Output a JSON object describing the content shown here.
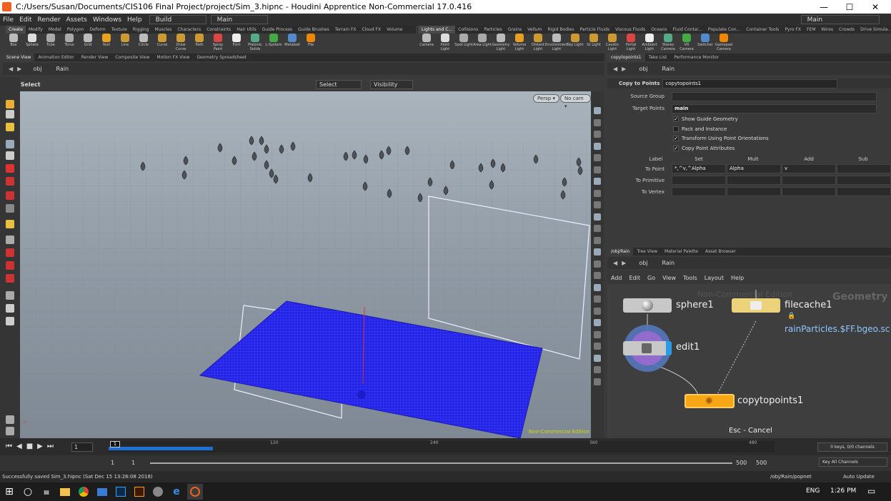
{
  "window": {
    "title": "C:/Users/Susan/Documents/CIS106 Final Project/project/Sim_3.hipnc - Houdini Apprentice Non-Commercial 17.0.416",
    "minimize": "—",
    "maximize": "☐",
    "close": "✕"
  },
  "menu": {
    "items": [
      "File",
      "Edit",
      "Render",
      "Assets",
      "Windows",
      "Help"
    ],
    "desktop": "Build",
    "context": "Main",
    "right_context": "Main"
  },
  "shelf": {
    "tabs_left": [
      "Create",
      "Modify",
      "Model",
      "Polygon",
      "Deform",
      "Texture",
      "Rigging",
      "Muscles",
      "Characters",
      "Constraints",
      "Hair Utils",
      "Guide Process",
      "Guide Brushes",
      "Terrain FX",
      "Cloud FX",
      "Volume"
    ],
    "tabs_right": [
      "Lights and C...",
      "Collisions",
      "Particles",
      "Grains",
      "Vellum",
      "Rigid Bodies",
      "Particle Fluids",
      "Viscous Fluids",
      "Oceans",
      "Fluid Contai...",
      "Populate Con...",
      "Container Tools",
      "Pyro FX",
      "FEM",
      "Wires",
      "Crowds",
      "Drive Simula..."
    ],
    "tools_left": [
      "Box",
      "Sphere",
      "Tube",
      "Torus",
      "Grid",
      "Null",
      "Line",
      "Circle",
      "Curve",
      "Draw Curve",
      "Path",
      "Spray Paint",
      "Font",
      "Platonic Solids",
      "L-System",
      "Metaball",
      "File"
    ],
    "tools_right": [
      "Camera",
      "Point Light",
      "Spot Light",
      "Area Light",
      "Geometry Light",
      "Volume Light",
      "Distant Light",
      "Environment Light",
      "Sky Light",
      "GI Light",
      "Caustic Light",
      "Portal Light",
      "Ambient Light",
      "Stereo Camera",
      "VR Camera",
      "Switcher",
      "Gamepad Camera"
    ]
  },
  "left_pane": {
    "tabs": [
      "Scene View",
      "Animation Editor",
      "Render View",
      "Composite View",
      "Motion FX View",
      "Geometry Spreadsheet"
    ],
    "path": [
      "obj",
      "Rain"
    ],
    "tool": "Select",
    "select_mode": "Select",
    "visibility": "Visibility",
    "persp": "Persp",
    "cam": "No cam",
    "watermark": "Non-Commercial Edition"
  },
  "right_top": {
    "tabs": [
      "copytopoints1",
      "Take List",
      "Performance Monitor"
    ],
    "path": [
      "obj",
      "Rain"
    ],
    "node_type": "Copy to Points",
    "node_name": "copytopoints1",
    "source_group_label": "Source Group",
    "source_group_value": "",
    "target_points_label": "Target Points",
    "target_points_value": "main",
    "checks": [
      {
        "label": "Show Guide Geometry",
        "checked": "✓"
      },
      {
        "label": "Pack and Instance",
        "checked": ""
      },
      {
        "label": "Transform Using Point Orientations",
        "checked": "✓"
      },
      {
        "label": "Copy Point Attributes",
        "checked": "✓"
      }
    ],
    "cols": [
      "Label",
      "Set",
      "Mult",
      "Add",
      "Sub"
    ],
    "rows": [
      {
        "label": "To Point",
        "set": "*,^v,^Alpha",
        "mult": "Alpha",
        "add": "v",
        "sub": ""
      },
      {
        "label": "To Primitive",
        "set": "",
        "mult": "",
        "add": "",
        "sub": ""
      },
      {
        "label": "To Vertex",
        "set": "",
        "mult": "",
        "add": "",
        "sub": ""
      }
    ]
  },
  "right_bottom": {
    "tabs": [
      "/obj/Rain",
      "Tree View",
      "Material Palette",
      "Asset Browser"
    ],
    "path": [
      "obj",
      "Rain"
    ],
    "menu": [
      "Add",
      "Edit",
      "Go",
      "View",
      "Tools",
      "Layout",
      "Help"
    ],
    "watermark": "Non-Commercial Edition",
    "context_label": "Geometry",
    "nodes": {
      "sphere": "sphere1",
      "filecache": "filecache1",
      "filecache_path": "rainParticles.$FF.bgeo.sc",
      "edit": "edit1",
      "copy": "copytopoints1"
    },
    "hint": "Esc - Cancel"
  },
  "timeline": {
    "current_frame": "1",
    "frame_field": "1",
    "ticks": [
      "120",
      "240",
      "360",
      "480"
    ],
    "keys": "0 keys, 0/0 channels",
    "key_channels": "Key All Channels",
    "progress": 0.27
  },
  "range": {
    "start": "1",
    "start2": "1",
    "end": "500",
    "end2": "500"
  },
  "status": {
    "message": "Successfully saved Sim_3.hipnc (Sat Dec 15 13:26:08 2018)",
    "path": "/obj/Rain/popnet",
    "update": "Auto Update"
  },
  "taskbar": {
    "lang": "ENG",
    "time": "1:26 PM"
  },
  "colors": {
    "accent": "#f0a818",
    "grid_plane": "#2323e8",
    "node_gray": "#c8c8c8",
    "node_yellow": "#ecd27a",
    "node_orange": "#f7a616",
    "timeline_fill": "#1e6fd6"
  }
}
